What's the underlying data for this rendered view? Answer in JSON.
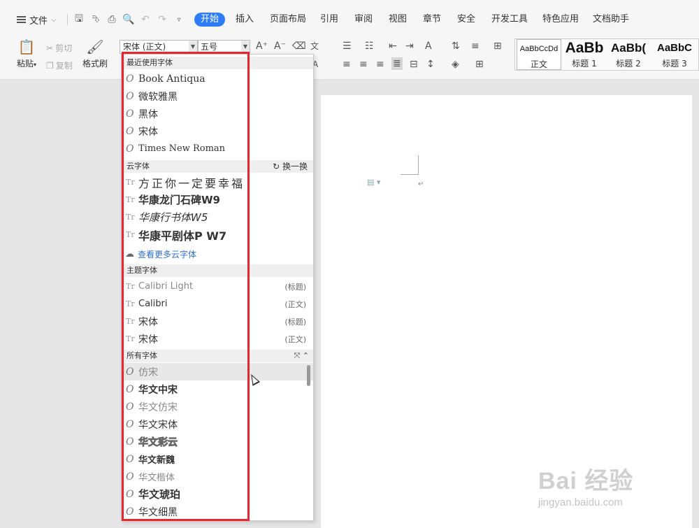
{
  "menubar": {
    "file": "文件",
    "tabs": [
      "开始",
      "插入",
      "页面布局",
      "引用",
      "审阅",
      "视图",
      "章节",
      "安全",
      "开发工具",
      "特色应用",
      "文档助手"
    ],
    "active_tab": "开始"
  },
  "ribbon": {
    "paste": "粘贴",
    "cut": "剪切",
    "copy": "复制",
    "format_painter": "格式刷",
    "font_name": "宋体 (正文)",
    "font_size": "五号",
    "styles": [
      {
        "sample": "AaBbCcDd",
        "label": "正文"
      },
      {
        "sample": "AaBb",
        "label": "标题 1"
      },
      {
        "sample": "AaBb(",
        "label": "标题 2"
      },
      {
        "sample": "AaBbC",
        "label": "标题 3"
      }
    ]
  },
  "font_dropdown": {
    "recent_header": "最近使用字体",
    "recent": [
      "Book Antiqua",
      "微软雅黑",
      "黑体",
      "宋体",
      "Times New Roman"
    ],
    "cloud_header": "云字体",
    "cloud_action": "换一换",
    "cloud": [
      "方正你一定要幸福",
      "华康龙门石碑W9",
      "华康行书体W5",
      "华康平剧体P W7"
    ],
    "cloud_more": "查看更多云字体",
    "theme_header": "主题字体",
    "theme": [
      {
        "name": "Calibri Light",
        "tag": "(标题)"
      },
      {
        "name": "Calibri",
        "tag": "(正文)"
      },
      {
        "name": "宋体",
        "tag": "(标题)"
      },
      {
        "name": "宋体",
        "tag": "(正文)"
      }
    ],
    "all_header": "所有字体",
    "all": [
      "仿宋",
      "华文中宋",
      "华文仿宋",
      "华文宋体",
      "华文彩云",
      "华文新魏",
      "华文楷体",
      "华文琥珀",
      "华文细黑"
    ]
  },
  "watermark": {
    "brand": "Bai 经验",
    "url": "jingyan.baidu.com"
  },
  "colors": {
    "accent": "#2e7df6",
    "highlight": "#e8262b"
  }
}
